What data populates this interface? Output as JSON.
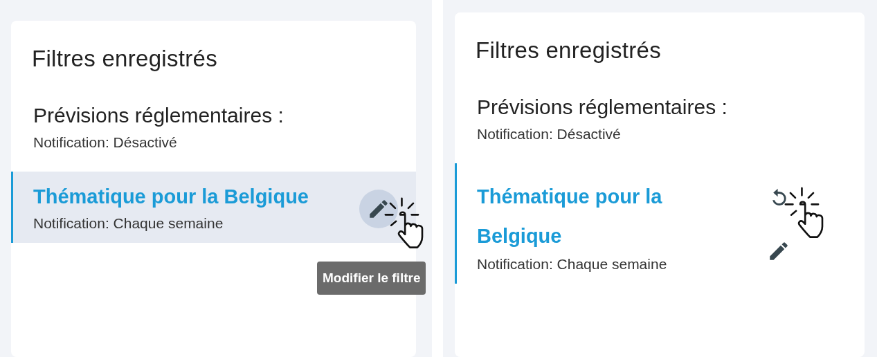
{
  "panels": [
    {
      "title": "Filtres enregistrés",
      "tooltip": "Modifier le filtre",
      "filters": [
        {
          "name": "Prévisions réglementaires :",
          "notification": "Notification: Désactivé",
          "selected": false,
          "highlighted": false
        },
        {
          "name": "Thématique pour la Belgique",
          "notification": "Notification: Chaque semaine",
          "selected": true,
          "highlighted": true,
          "actions": [
            {
              "kind": "edit",
              "hovered": true
            }
          ]
        }
      ]
    },
    {
      "title": "Filtres enregistrés",
      "filters": [
        {
          "name": "Prévisions réglementaires :",
          "notification": "Notification: Désactivé",
          "selected": false,
          "highlighted": false
        },
        {
          "name": "Thématique pour la Belgique",
          "notification": "Notification: Chaque semaine",
          "selected": true,
          "highlighted": false,
          "actions": [
            {
              "kind": "reset",
              "hovered": true
            },
            {
              "kind": "edit",
              "hovered": false
            }
          ]
        }
      ]
    }
  ]
}
